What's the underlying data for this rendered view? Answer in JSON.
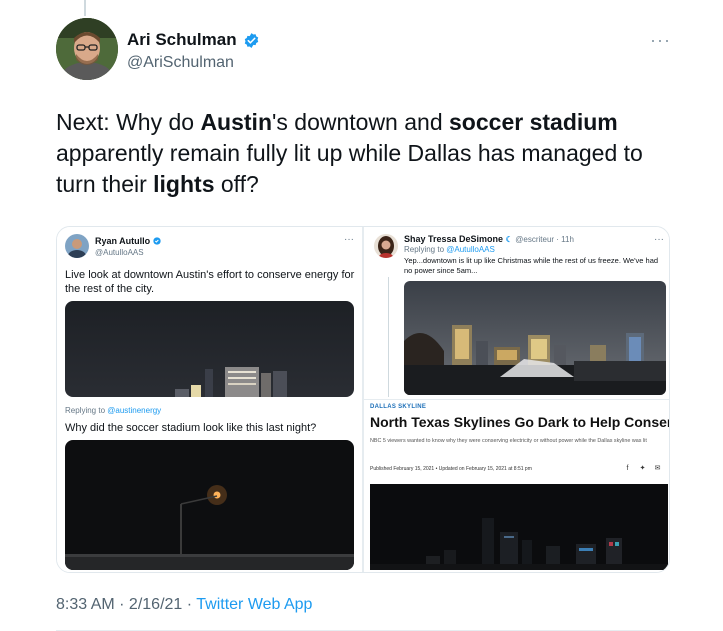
{
  "tweet": {
    "author_name": "Ari Schulman",
    "author_handle": "@AriSchulman",
    "text_parts": [
      {
        "t": "Next: Why do ",
        "bold": false
      },
      {
        "t": "Austin",
        "bold": true
      },
      {
        "t": "'s downtown and ",
        "bold": false
      },
      {
        "t": "soccer stadium",
        "bold": true
      },
      {
        "t": " apparently remain fully lit up while Dallas has managed to turn their ",
        "bold": false
      },
      {
        "t": "lights",
        "bold": true
      },
      {
        "t": " off?",
        "bold": false
      }
    ],
    "time": "8:33 AM",
    "date": "2/16/21",
    "source": "Twitter Web App",
    "more_icon": "more-dots-icon"
  },
  "embed_left": {
    "name": "Ryan Autullo",
    "handle": "@AutulloAAS",
    "text": "Live look at downtown Austin's effort to conserve energy for the rest of the city.",
    "reply_prefix": "Replying to ",
    "reply_to": "@austinenergy",
    "reply_text": "Why did the soccer stadium look like this last night?"
  },
  "embed_right": {
    "name": "Shay Tressa DeSimone",
    "handle": "@escriteur · 11h",
    "reply_prefix": "Replying to ",
    "reply_to": "@AutulloAAS",
    "text": "Yep...downtown is lit up like Christmas while the rest of us freeze. We've had no power since 5am...",
    "article_kicker": "DALLAS SKYLINE",
    "article_title": "North Texas Skylines Go Dark to Help Conserve",
    "article_sub": "NBC 5 viewers wanted to know why they were conserving electricity or without power while the Dallas skyline was lit",
    "article_date": "Published February 15, 2021 • Updated on February 15, 2021 at 8:51 pm"
  },
  "colors": {
    "verified": "#1d9bf0",
    "link": "#1d9bf0",
    "secondary_text": "#536471"
  }
}
